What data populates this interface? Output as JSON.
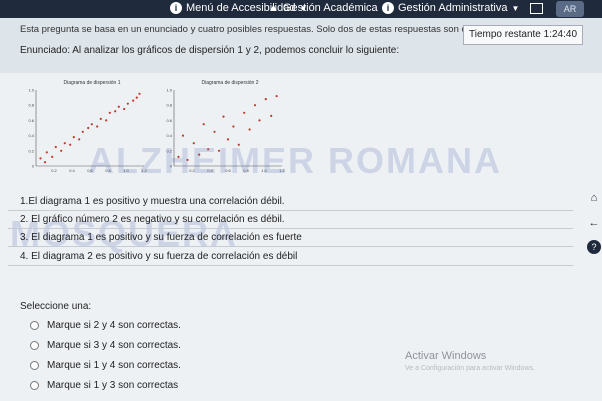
{
  "topbar": {
    "accessibility_menu": "Menú de Accesibilidad",
    "academic": "Gestión Académica",
    "admin": "Gestión Administrativa",
    "avatar": "AR"
  },
  "question": {
    "intro": "Esta pregunta se basa en un enunciado y cuatro posibles respuestas. Solo dos de estas respuestas son cor",
    "timer": "Tiempo restante 1:24:40",
    "prompt": "Enunciado: Al analizar los gráficos de dispersión 1 y 2, podemos concluir lo siguiente:",
    "statements": [
      "1.El diagrama 1 es positivo y muestra una correlación débil.",
      "2. El gráfico número 2 es negativo y su correlación es débil.",
      "3. El diagrama 1 es positivo y su fuerza de correlación es fuerte",
      "4. El diagrama 2 es positivo y su fuerza de correlación es débil"
    ],
    "select_label": "Seleccione una:",
    "options": [
      "Marque si 2 y 4 son correctas.",
      "Marque si 3 y 4 son correctas.",
      "Marque si 1 y 4 son correctas.",
      "Marque si 1 y 3 son correctas"
    ]
  },
  "watermark": {
    "line1": "ALZHEIMER ROMANA",
    "line2": "MOSQUERA"
  },
  "windows": {
    "activate": "Activar Windows",
    "hint": "Ve a Configuración para activar Windows."
  },
  "colors": {
    "topbar": "#1f2a3c",
    "points": "#c0392b"
  },
  "chart_data": [
    {
      "type": "scatter",
      "title": "Diagrama de dispersión 1",
      "xlim": [
        0,
        1.2
      ],
      "ylim": [
        0,
        1.0
      ],
      "ytick_labels": [
        "1.0",
        "0.8",
        "0.6",
        "0.4",
        "0.2",
        "0"
      ],
      "xtick_labels": [
        "0.2",
        "0.4",
        "0.6",
        "0.8",
        "1.0",
        "1.2"
      ],
      "points": [
        [
          0.05,
          0.1
        ],
        [
          0.1,
          0.05
        ],
        [
          0.12,
          0.18
        ],
        [
          0.18,
          0.12
        ],
        [
          0.22,
          0.25
        ],
        [
          0.28,
          0.2
        ],
        [
          0.32,
          0.3
        ],
        [
          0.38,
          0.28
        ],
        [
          0.42,
          0.38
        ],
        [
          0.48,
          0.35
        ],
        [
          0.52,
          0.45
        ],
        [
          0.58,
          0.5
        ],
        [
          0.62,
          0.55
        ],
        [
          0.68,
          0.52
        ],
        [
          0.72,
          0.62
        ],
        [
          0.78,
          0.6
        ],
        [
          0.82,
          0.7
        ],
        [
          0.88,
          0.72
        ],
        [
          0.92,
          0.78
        ],
        [
          0.98,
          0.75
        ],
        [
          1.02,
          0.82
        ],
        [
          1.08,
          0.86
        ],
        [
          1.12,
          0.9
        ],
        [
          1.15,
          0.95
        ]
      ]
    },
    {
      "type": "scatter",
      "title": "Diagrama de dispersión 2",
      "xlim": [
        0,
        1.2
      ],
      "ylim": [
        0,
        1.0
      ],
      "ytick_labels": [
        "1.0",
        "0.8",
        "0.6",
        "0.4",
        "0.2",
        "0"
      ],
      "xtick_labels": [
        "0.2",
        "0.4",
        "0.6",
        "0.8",
        "1.0",
        "1.2"
      ],
      "points": [
        [
          0.05,
          0.12
        ],
        [
          0.1,
          0.4
        ],
        [
          0.15,
          0.08
        ],
        [
          0.22,
          0.3
        ],
        [
          0.28,
          0.15
        ],
        [
          0.33,
          0.55
        ],
        [
          0.38,
          0.22
        ],
        [
          0.45,
          0.45
        ],
        [
          0.5,
          0.2
        ],
        [
          0.55,
          0.65
        ],
        [
          0.6,
          0.35
        ],
        [
          0.66,
          0.52
        ],
        [
          0.72,
          0.28
        ],
        [
          0.78,
          0.7
        ],
        [
          0.84,
          0.48
        ],
        [
          0.9,
          0.8
        ],
        [
          0.95,
          0.6
        ],
        [
          1.02,
          0.88
        ],
        [
          1.08,
          0.66
        ],
        [
          1.14,
          0.92
        ]
      ]
    }
  ]
}
